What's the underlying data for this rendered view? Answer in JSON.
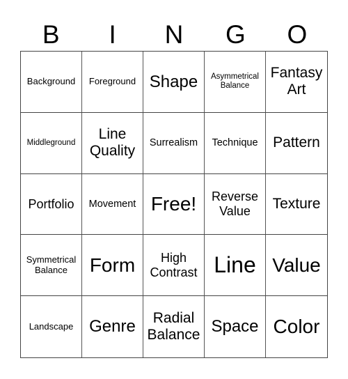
{
  "header": [
    "B",
    "I",
    "N",
    "G",
    "O"
  ],
  "cells": [
    {
      "text": "Background",
      "size": "s11"
    },
    {
      "text": "Foreground",
      "size": "s11"
    },
    {
      "text": "Shape",
      "size": "s22"
    },
    {
      "text": "Asymmetrical\nBalance",
      "size": "s10"
    },
    {
      "text": "Fantasy\nArt",
      "size": "s20"
    },
    {
      "text": "Middleground",
      "size": "s10"
    },
    {
      "text": "Line\nQuality",
      "size": "s20"
    },
    {
      "text": "Surrealism",
      "size": "s12"
    },
    {
      "text": "Technique",
      "size": "s12"
    },
    {
      "text": "Pattern",
      "size": "s20"
    },
    {
      "text": "Portfolio",
      "size": "s16"
    },
    {
      "text": "Movement",
      "size": "s12"
    },
    {
      "text": "Free!",
      "size": "s26"
    },
    {
      "text": "Reverse\nValue",
      "size": "s16"
    },
    {
      "text": "Texture",
      "size": "s20"
    },
    {
      "text": "Symmetrical\nBalance",
      "size": "s11"
    },
    {
      "text": "Form",
      "size": "s26"
    },
    {
      "text": "High\nContrast",
      "size": "s16"
    },
    {
      "text": "Line",
      "size": "s30"
    },
    {
      "text": "Value",
      "size": "s26"
    },
    {
      "text": "Landscape",
      "size": "s11"
    },
    {
      "text": "Genre",
      "size": "s22"
    },
    {
      "text": "Radial\nBalance",
      "size": "s20"
    },
    {
      "text": "Space",
      "size": "s22"
    },
    {
      "text": "Color",
      "size": "s26"
    }
  ]
}
